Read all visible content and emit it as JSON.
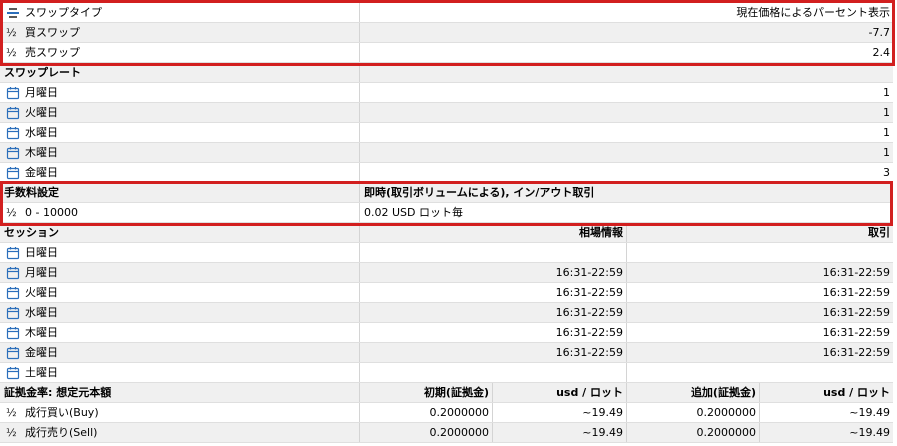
{
  "swap": {
    "type_label": "スワップタイプ",
    "type_value": "現在価格によるパーセント表示",
    "buy_label": "買スワップ",
    "buy_value": "-7.7",
    "sell_label": "売スワップ",
    "sell_value": "2.4"
  },
  "swap_rate": {
    "header": "スワップレート",
    "days": [
      {
        "label": "月曜日",
        "value": "1"
      },
      {
        "label": "火曜日",
        "value": "1"
      },
      {
        "label": "水曜日",
        "value": "1"
      },
      {
        "label": "木曜日",
        "value": "1"
      },
      {
        "label": "金曜日",
        "value": "3"
      }
    ]
  },
  "commission": {
    "header": "手数料設定",
    "header_value": "即時(取引ボリュームによる), イン/アウト取引",
    "range_label": "0 - 10000",
    "range_value": "0.02 USD ロット毎"
  },
  "session": {
    "header": "セッション",
    "col_quotes": "相場情報",
    "col_trade": "取引",
    "days": [
      {
        "label": "日曜日",
        "quotes": "",
        "trade": ""
      },
      {
        "label": "月曜日",
        "quotes": "16:31-22:59",
        "trade": "16:31-22:59"
      },
      {
        "label": "火曜日",
        "quotes": "16:31-22:59",
        "trade": "16:31-22:59"
      },
      {
        "label": "水曜日",
        "quotes": "16:31-22:59",
        "trade": "16:31-22:59"
      },
      {
        "label": "木曜日",
        "quotes": "16:31-22:59",
        "trade": "16:31-22:59"
      },
      {
        "label": "金曜日",
        "quotes": "16:31-22:59",
        "trade": "16:31-22:59"
      },
      {
        "label": "土曜日",
        "quotes": "",
        "trade": ""
      }
    ]
  },
  "margin": {
    "header": "証拠金率: 想定元本額",
    "col_initial": "初期(証拠金)",
    "col_unit1": "usd / ロット",
    "col_additional": "追加(証拠金)",
    "col_unit2": "usd / ロット",
    "rows": [
      {
        "label": "成行買い(Buy)",
        "initial": "0.2000000",
        "unit1": "~19.49",
        "additional": "0.2000000",
        "unit2": "~19.49"
      },
      {
        "label": "成行売り(Sell)",
        "initial": "0.2000000",
        "unit1": "~19.49",
        "additional": "0.2000000",
        "unit2": "~19.49"
      }
    ]
  },
  "colors": {
    "highlight_border": "#d21f1f",
    "icon_blue": "#2a6ebb"
  },
  "icons": {
    "swap_type": "list-icon",
    "half": "one-half-icon",
    "day": "calendar-icon"
  }
}
